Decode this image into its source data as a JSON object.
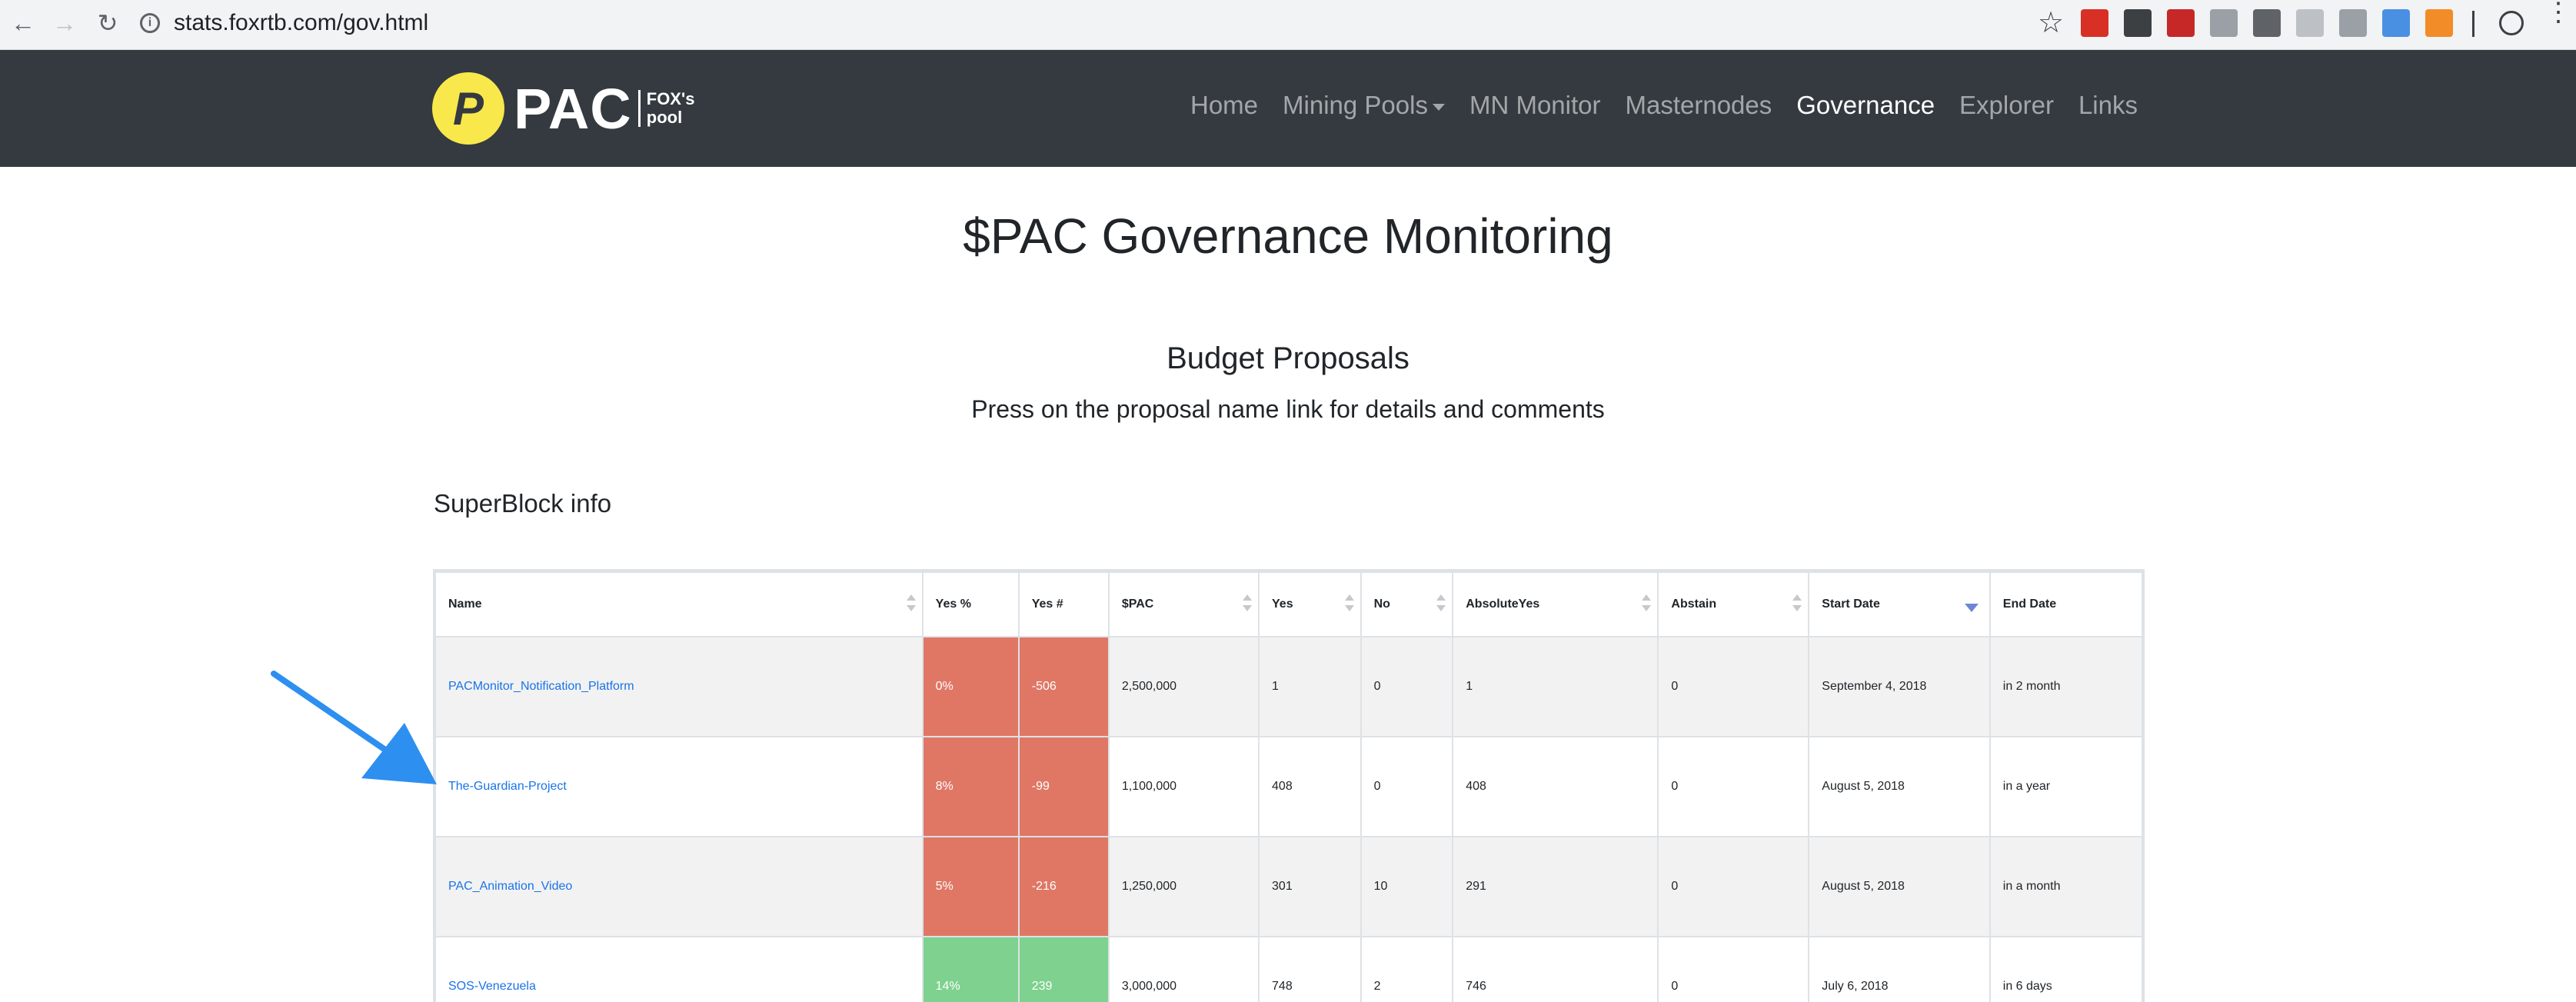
{
  "browser": {
    "url": "stats.foxrtb.com/gov.html"
  },
  "navbar": {
    "logo_text": "PAC",
    "logo_sub_1": "FOX's",
    "logo_sub_2": "pool",
    "links": [
      {
        "label": "Home"
      },
      {
        "label": "Mining Pools"
      },
      {
        "label": "MN Monitor"
      },
      {
        "label": "Masternodes"
      },
      {
        "label": "Governance"
      },
      {
        "label": "Explorer"
      },
      {
        "label": "Links"
      }
    ]
  },
  "page": {
    "title": "$PAC Governance Monitoring",
    "subtitle": "Budget Proposals",
    "description": "Press on the proposal name link for details and comments",
    "superblock": "SuperBlock info"
  },
  "table": {
    "headers": [
      "Name",
      "Yes %",
      "Yes #",
      "$PAC",
      "Yes",
      "No",
      "AbsoluteYes",
      "Abstain",
      "Start Date",
      "End Date"
    ],
    "rows": [
      {
        "name": "PACMonitor_Notification_Platform",
        "yes_pct": "0%",
        "yes_num": "-506",
        "pac": "2,500,000",
        "yes": "1",
        "no": "0",
        "absolute_yes": "1",
        "abstain": "0",
        "start_date": "September 4, 2018",
        "end_date": "in 2 month",
        "status": "red"
      },
      {
        "name": "The-Guardian-Project",
        "yes_pct": "8%",
        "yes_num": "-99",
        "pac": "1,100,000",
        "yes": "408",
        "no": "0",
        "absolute_yes": "408",
        "abstain": "0",
        "start_date": "August 5, 2018",
        "end_date": "in a year",
        "status": "red"
      },
      {
        "name": "PAC_Animation_Video",
        "yes_pct": "5%",
        "yes_num": "-216",
        "pac": "1,250,000",
        "yes": "301",
        "no": "10",
        "absolute_yes": "291",
        "abstain": "0",
        "start_date": "August 5, 2018",
        "end_date": "in a month",
        "status": "red"
      },
      {
        "name": "SOS-Venezuela",
        "yes_pct": "14%",
        "yes_num": "239",
        "pac": "3,000,000",
        "yes": "748",
        "no": "2",
        "absolute_yes": "746",
        "abstain": "0",
        "start_date": "July 6, 2018",
        "end_date": "in 6 days",
        "status": "green"
      }
    ]
  },
  "colors": {
    "navbar": "#343a40",
    "status_red": "#e07765",
    "status_green": "#7ed18e",
    "link": "#1a73e8",
    "arrow": "#2d8ff0"
  }
}
